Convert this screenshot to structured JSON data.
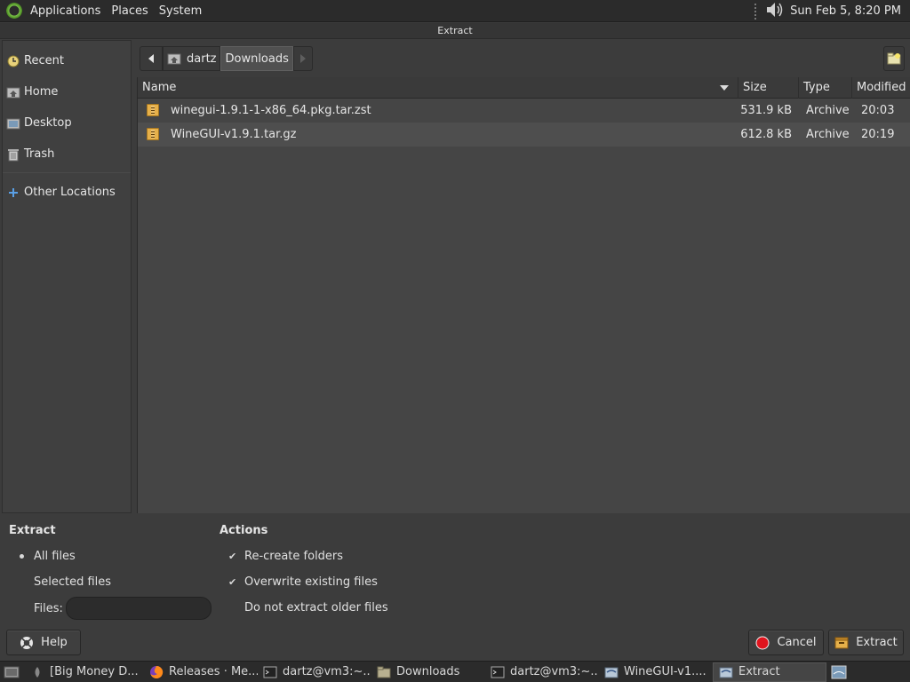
{
  "top_panel": {
    "menus": [
      "Applications",
      "Places",
      "System"
    ],
    "clock": "Sun Feb  5,  8:20 PM"
  },
  "window": {
    "title": "Extract"
  },
  "sidebar": {
    "items": [
      {
        "label": "Recent",
        "icon": "recent-icon"
      },
      {
        "label": "Home",
        "icon": "home-icon"
      },
      {
        "label": "Desktop",
        "icon": "desktop-icon"
      },
      {
        "label": "Trash",
        "icon": "trash-icon"
      },
      {
        "label": "Other Locations",
        "icon": "plus-icon"
      }
    ]
  },
  "pathbar": {
    "home": "dartz",
    "current": "Downloads"
  },
  "filelist": {
    "columns": [
      "Name",
      "Size",
      "Type",
      "Modified"
    ],
    "rows": [
      {
        "name": "winegui-1.9.1-1-x86_64.pkg.tar.zst",
        "size": "531.9 kB",
        "type": "Archive",
        "modified": "20:03"
      },
      {
        "name": "WineGUI-v1.9.1.tar.gz",
        "size": "612.8 kB",
        "type": "Archive",
        "modified": "20:19"
      }
    ]
  },
  "extract_options": {
    "heading": "Extract",
    "all_files": "All files",
    "selected_files": "Selected files",
    "files_label": "Files:",
    "files_value": ""
  },
  "actions": {
    "heading": "Actions",
    "recreate": "Re-create folders",
    "overwrite": "Overwrite existing files",
    "no_older": "Do not extract older files"
  },
  "buttons": {
    "help": "Help",
    "cancel": "Cancel",
    "extract": "Extract"
  },
  "taskbar": {
    "tasks": [
      "[Big Money D...",
      "Releases · Me...",
      "dartz@vm3:~...",
      "Downloads",
      "dartz@vm3:~...",
      "WineGUI-v1....",
      "Extract"
    ]
  },
  "colors": {
    "accent_red": "#e0141e",
    "archive_yellow": "#e6b04a"
  }
}
